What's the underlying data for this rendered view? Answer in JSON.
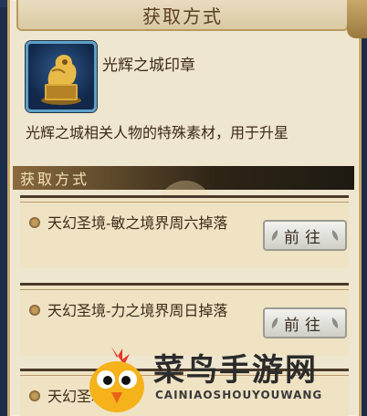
{
  "dialog": {
    "title": "获取方式"
  },
  "item": {
    "name": "光辉之城印章",
    "description": "光辉之城相关人物的特殊素材，用于升星",
    "icon": "golden-lion-seal-icon"
  },
  "section": {
    "title": "获取方式"
  },
  "sources": [
    {
      "text": "天幻圣境-敏之境界周六掉落",
      "button": "前往"
    },
    {
      "text": "天幻圣境-力之境界周日掉落",
      "button": "前往"
    },
    {
      "text": "天幻圣境-",
      "button": ""
    }
  ],
  "watermark": {
    "text": "菜鸟手游网",
    "sub": "CAINIAOSHOUYOUWANG",
    "logo": "cainiao-bird-logo"
  },
  "colors": {
    "panel": "#efe6cf",
    "section_header": "#2d2416",
    "text": "#3d2a17"
  }
}
